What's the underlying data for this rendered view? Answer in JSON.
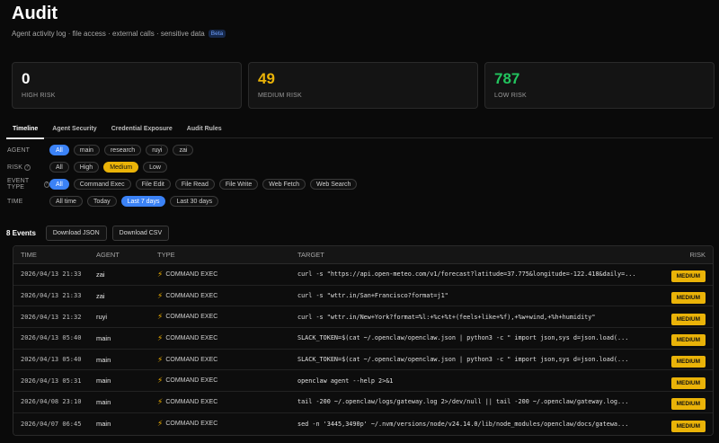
{
  "header": {
    "title": "Audit",
    "subtitle": "Agent activity log · file access · external calls · sensitive data",
    "badge": "Beta"
  },
  "cards": [
    {
      "value": "0",
      "label": "HIGH RISK",
      "color": "#ffffff"
    },
    {
      "value": "49",
      "label": "MEDIUM RISK",
      "color": "#eab308"
    },
    {
      "value": "787",
      "label": "LOW RISK",
      "color": "#22c55e"
    }
  ],
  "tabs": [
    "Timeline",
    "Agent Security",
    "Credential Exposure",
    "Audit Rules"
  ],
  "filters": {
    "agent": {
      "label": "AGENT",
      "options": [
        "All",
        "main",
        "research",
        "ruyi",
        "zai"
      ],
      "selected": "All"
    },
    "risk": {
      "label": "RISK",
      "options": [
        "All",
        "High",
        "Medium",
        "Low"
      ],
      "selected": "Medium"
    },
    "event_type": {
      "label": "EVENT TYPE",
      "options": [
        "All",
        "Command Exec",
        "File Edit",
        "File Read",
        "File Write",
        "Web Fetch",
        "Web Search"
      ],
      "selected": "All"
    },
    "time": {
      "label": "TIME",
      "options": [
        "All time",
        "Today",
        "Last 7 days",
        "Last 30 days"
      ],
      "selected": "Last 7 days"
    }
  },
  "events": {
    "count_label": "8 Events",
    "download_json": "Download JSON",
    "download_csv": "Download CSV"
  },
  "table": {
    "headers": [
      "TIME",
      "AGENT",
      "TYPE",
      "TARGET",
      "RISK"
    ],
    "rows": [
      {
        "time": "2026/04/13 21:33",
        "agent": "zai",
        "type": "COMMAND EXEC",
        "target": "curl -s \"https://api.open-meteo.com/v1/forecast?latitude=37.775&longitude=-122.418&daily=...",
        "risk": "MEDIUM"
      },
      {
        "time": "2026/04/13 21:33",
        "agent": "zai",
        "type": "COMMAND EXEC",
        "target": "curl -s \"wttr.in/San+Francisco?format=j1\"",
        "risk": "MEDIUM"
      },
      {
        "time": "2026/04/13 21:32",
        "agent": "ruyi",
        "type": "COMMAND EXEC",
        "target": "curl -s \"wttr.in/New+York?format=%l:+%c+%t+(feels+like+%f),+%w+wind,+%h+humidity\"",
        "risk": "MEDIUM"
      },
      {
        "time": "2026/04/13 05:40",
        "agent": "main",
        "type": "COMMAND EXEC",
        "target": "SLACK_TOKEN=$(cat ~/.openclaw/openclaw.json | python3 -c \" import json,sys d=json.load(...",
        "risk": "MEDIUM"
      },
      {
        "time": "2026/04/13 05:40",
        "agent": "main",
        "type": "COMMAND EXEC",
        "target": "SLACK_TOKEN=$(cat ~/.openclaw/openclaw.json | python3 -c \" import json,sys d=json.load(...",
        "risk": "MEDIUM"
      },
      {
        "time": "2026/04/13 05:31",
        "agent": "main",
        "type": "COMMAND EXEC",
        "target": "openclaw agent --help 2>&1",
        "risk": "MEDIUM"
      },
      {
        "time": "2026/04/08 23:10",
        "agent": "main",
        "type": "COMMAND EXEC",
        "target": "tail -200 ~/.openclaw/logs/gateway.log 2>/dev/null || tail -200 ~/.openclaw/gateway.log...",
        "risk": "MEDIUM"
      },
      {
        "time": "2026/04/07 06:45",
        "agent": "main",
        "type": "COMMAND EXEC",
        "target": "sed -n '3445,3490p' ~/.nvm/versions/node/v24.14.0/lib/node_modules/openclaw/docs/gatewa...",
        "risk": "MEDIUM"
      }
    ]
  },
  "icons": {
    "info": "question-circle-icon",
    "type": "lightning-bolt-icon"
  }
}
